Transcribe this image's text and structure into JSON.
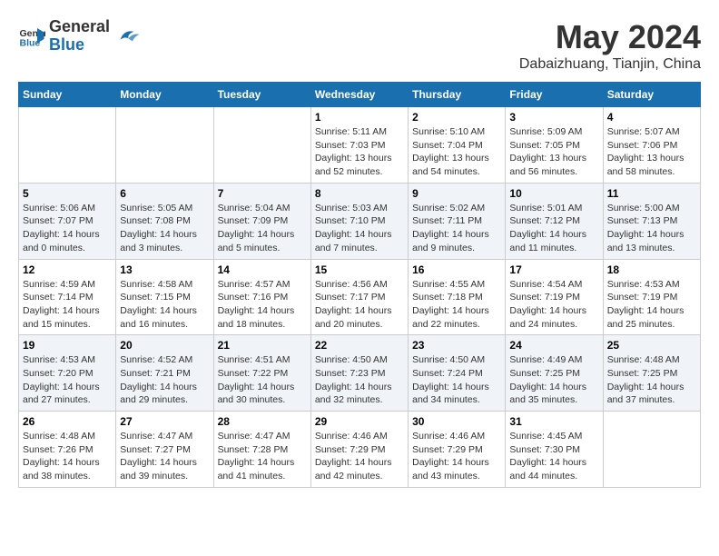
{
  "header": {
    "logo_general": "General",
    "logo_blue": "Blue",
    "title": "May 2024",
    "location": "Dabaizhuang, Tianjin, China"
  },
  "weekdays": [
    "Sunday",
    "Monday",
    "Tuesday",
    "Wednesday",
    "Thursday",
    "Friday",
    "Saturday"
  ],
  "weeks": [
    [
      {
        "day": "",
        "sunrise": "",
        "sunset": "",
        "daylight": ""
      },
      {
        "day": "",
        "sunrise": "",
        "sunset": "",
        "daylight": ""
      },
      {
        "day": "",
        "sunrise": "",
        "sunset": "",
        "daylight": ""
      },
      {
        "day": "1",
        "sunrise": "Sunrise: 5:11 AM",
        "sunset": "Sunset: 7:03 PM",
        "daylight": "Daylight: 13 hours and 52 minutes."
      },
      {
        "day": "2",
        "sunrise": "Sunrise: 5:10 AM",
        "sunset": "Sunset: 7:04 PM",
        "daylight": "Daylight: 13 hours and 54 minutes."
      },
      {
        "day": "3",
        "sunrise": "Sunrise: 5:09 AM",
        "sunset": "Sunset: 7:05 PM",
        "daylight": "Daylight: 13 hours and 56 minutes."
      },
      {
        "day": "4",
        "sunrise": "Sunrise: 5:07 AM",
        "sunset": "Sunset: 7:06 PM",
        "daylight": "Daylight: 13 hours and 58 minutes."
      }
    ],
    [
      {
        "day": "5",
        "sunrise": "Sunrise: 5:06 AM",
        "sunset": "Sunset: 7:07 PM",
        "daylight": "Daylight: 14 hours and 0 minutes."
      },
      {
        "day": "6",
        "sunrise": "Sunrise: 5:05 AM",
        "sunset": "Sunset: 7:08 PM",
        "daylight": "Daylight: 14 hours and 3 minutes."
      },
      {
        "day": "7",
        "sunrise": "Sunrise: 5:04 AM",
        "sunset": "Sunset: 7:09 PM",
        "daylight": "Daylight: 14 hours and 5 minutes."
      },
      {
        "day": "8",
        "sunrise": "Sunrise: 5:03 AM",
        "sunset": "Sunset: 7:10 PM",
        "daylight": "Daylight: 14 hours and 7 minutes."
      },
      {
        "day": "9",
        "sunrise": "Sunrise: 5:02 AM",
        "sunset": "Sunset: 7:11 PM",
        "daylight": "Daylight: 14 hours and 9 minutes."
      },
      {
        "day": "10",
        "sunrise": "Sunrise: 5:01 AM",
        "sunset": "Sunset: 7:12 PM",
        "daylight": "Daylight: 14 hours and 11 minutes."
      },
      {
        "day": "11",
        "sunrise": "Sunrise: 5:00 AM",
        "sunset": "Sunset: 7:13 PM",
        "daylight": "Daylight: 14 hours and 13 minutes."
      }
    ],
    [
      {
        "day": "12",
        "sunrise": "Sunrise: 4:59 AM",
        "sunset": "Sunset: 7:14 PM",
        "daylight": "Daylight: 14 hours and 15 minutes."
      },
      {
        "day": "13",
        "sunrise": "Sunrise: 4:58 AM",
        "sunset": "Sunset: 7:15 PM",
        "daylight": "Daylight: 14 hours and 16 minutes."
      },
      {
        "day": "14",
        "sunrise": "Sunrise: 4:57 AM",
        "sunset": "Sunset: 7:16 PM",
        "daylight": "Daylight: 14 hours and 18 minutes."
      },
      {
        "day": "15",
        "sunrise": "Sunrise: 4:56 AM",
        "sunset": "Sunset: 7:17 PM",
        "daylight": "Daylight: 14 hours and 20 minutes."
      },
      {
        "day": "16",
        "sunrise": "Sunrise: 4:55 AM",
        "sunset": "Sunset: 7:18 PM",
        "daylight": "Daylight: 14 hours and 22 minutes."
      },
      {
        "day": "17",
        "sunrise": "Sunrise: 4:54 AM",
        "sunset": "Sunset: 7:19 PM",
        "daylight": "Daylight: 14 hours and 24 minutes."
      },
      {
        "day": "18",
        "sunrise": "Sunrise: 4:53 AM",
        "sunset": "Sunset: 7:19 PM",
        "daylight": "Daylight: 14 hours and 25 minutes."
      }
    ],
    [
      {
        "day": "19",
        "sunrise": "Sunrise: 4:53 AM",
        "sunset": "Sunset: 7:20 PM",
        "daylight": "Daylight: 14 hours and 27 minutes."
      },
      {
        "day": "20",
        "sunrise": "Sunrise: 4:52 AM",
        "sunset": "Sunset: 7:21 PM",
        "daylight": "Daylight: 14 hours and 29 minutes."
      },
      {
        "day": "21",
        "sunrise": "Sunrise: 4:51 AM",
        "sunset": "Sunset: 7:22 PM",
        "daylight": "Daylight: 14 hours and 30 minutes."
      },
      {
        "day": "22",
        "sunrise": "Sunrise: 4:50 AM",
        "sunset": "Sunset: 7:23 PM",
        "daylight": "Daylight: 14 hours and 32 minutes."
      },
      {
        "day": "23",
        "sunrise": "Sunrise: 4:50 AM",
        "sunset": "Sunset: 7:24 PM",
        "daylight": "Daylight: 14 hours and 34 minutes."
      },
      {
        "day": "24",
        "sunrise": "Sunrise: 4:49 AM",
        "sunset": "Sunset: 7:25 PM",
        "daylight": "Daylight: 14 hours and 35 minutes."
      },
      {
        "day": "25",
        "sunrise": "Sunrise: 4:48 AM",
        "sunset": "Sunset: 7:25 PM",
        "daylight": "Daylight: 14 hours and 37 minutes."
      }
    ],
    [
      {
        "day": "26",
        "sunrise": "Sunrise: 4:48 AM",
        "sunset": "Sunset: 7:26 PM",
        "daylight": "Daylight: 14 hours and 38 minutes."
      },
      {
        "day": "27",
        "sunrise": "Sunrise: 4:47 AM",
        "sunset": "Sunset: 7:27 PM",
        "daylight": "Daylight: 14 hours and 39 minutes."
      },
      {
        "day": "28",
        "sunrise": "Sunrise: 4:47 AM",
        "sunset": "Sunset: 7:28 PM",
        "daylight": "Daylight: 14 hours and 41 minutes."
      },
      {
        "day": "29",
        "sunrise": "Sunrise: 4:46 AM",
        "sunset": "Sunset: 7:29 PM",
        "daylight": "Daylight: 14 hours and 42 minutes."
      },
      {
        "day": "30",
        "sunrise": "Sunrise: 4:46 AM",
        "sunset": "Sunset: 7:29 PM",
        "daylight": "Daylight: 14 hours and 43 minutes."
      },
      {
        "day": "31",
        "sunrise": "Sunrise: 4:45 AM",
        "sunset": "Sunset: 7:30 PM",
        "daylight": "Daylight: 14 hours and 44 minutes."
      },
      {
        "day": "",
        "sunrise": "",
        "sunset": "",
        "daylight": ""
      }
    ]
  ]
}
